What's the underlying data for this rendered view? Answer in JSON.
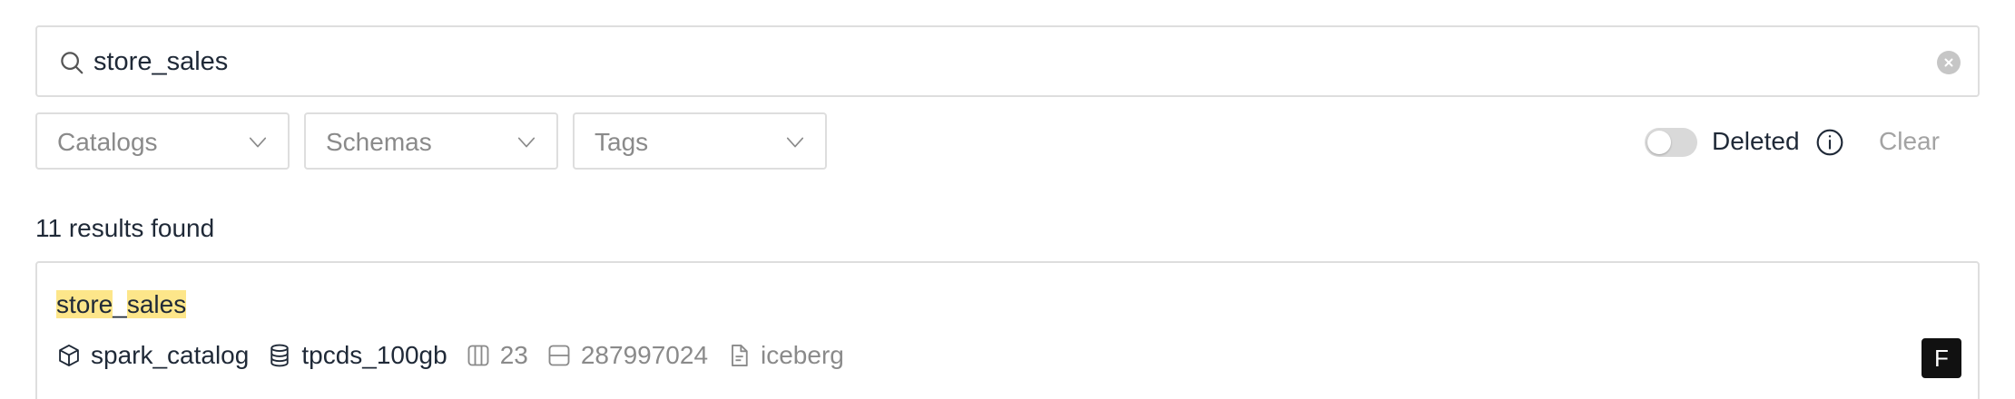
{
  "search": {
    "value": "store_sales",
    "icon": "search-icon",
    "clear_icon": "clear-circle-icon"
  },
  "filters": {
    "catalogs": {
      "label": "Catalogs"
    },
    "schemas": {
      "label": "Schemas"
    },
    "tags": {
      "label": "Tags"
    }
  },
  "deleted_toggle": {
    "label": "Deleted",
    "on": false
  },
  "clear_label": "Clear",
  "results": {
    "count_text": "11 results found",
    "items": [
      {
        "title_parts": [
          "store",
          "_",
          "sales"
        ],
        "catalog": "spark_catalog",
        "schema": "tpcds_100gb",
        "columns": "23",
        "rows": "287997024",
        "format": "iceberg",
        "badge": "F"
      }
    ]
  },
  "colors": {
    "highlight": "#fde68a",
    "border": "#dedede",
    "muted_text": "#8a8a8a",
    "badge_bg": "#111111"
  }
}
